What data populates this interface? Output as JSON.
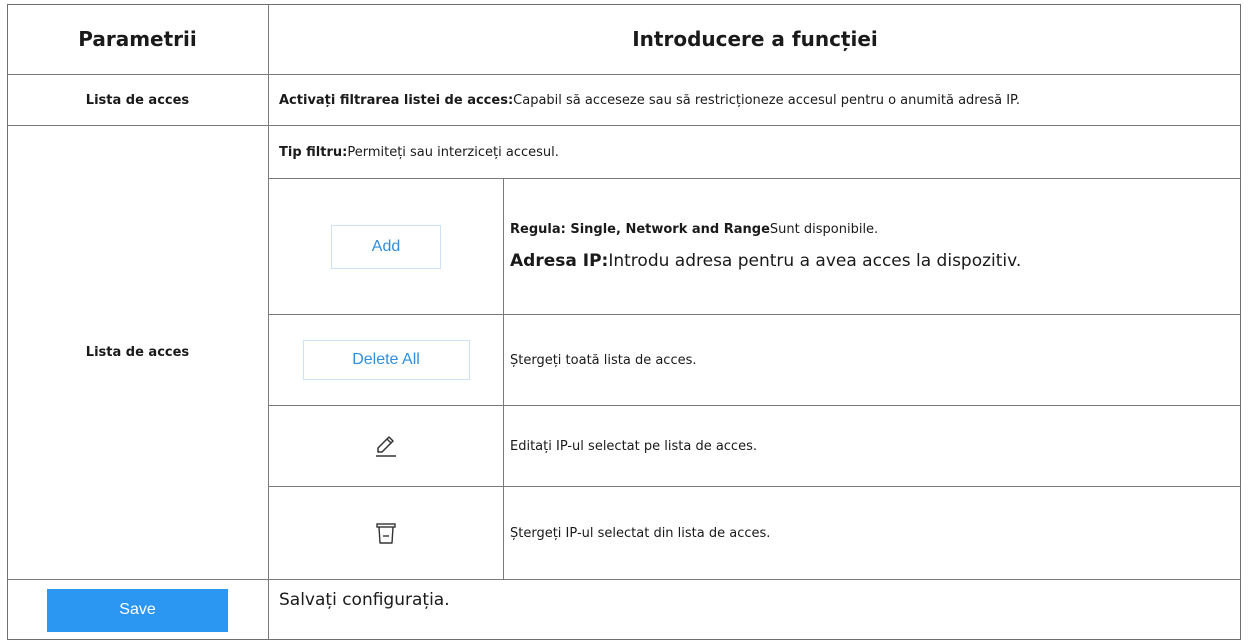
{
  "header": {
    "col1": "Parametrii",
    "col2": "Introducere a funcției"
  },
  "rows": {
    "access_list_filter": {
      "param": "Lista de acces",
      "bold": "Activați filtrarea listei de acces:",
      "text": "Capabil să acceseze sau să restricționeze accesul pentru o anumită adresă IP."
    },
    "access_list": {
      "param": "Lista de acces",
      "filter_type_bold": "Tip filtru:",
      "filter_type_text": "Permiteți sau interziceți accesul.",
      "add": {
        "button_label": "Add",
        "rule_bold": "Regula: Single, Network and Range",
        "rule_text": "Sunt disponibile.",
        "ip_bold": "Adresa IP:",
        "ip_text": "Introdu adresa pentru a avea acces la dispozitiv."
      },
      "delete_all": {
        "button_label": "Delete All",
        "text": "Ștergeți toată lista de acces."
      },
      "edit": {
        "icon": "pencil-icon",
        "text": "Editați IP-ul selectat pe lista de acces."
      },
      "delete": {
        "icon": "trash-icon",
        "text": "Ștergeți IP-ul selectat din lista de acces."
      }
    },
    "save": {
      "button_label": "Save",
      "text": "Salvați configurația."
    }
  },
  "colors": {
    "accent_blue": "#2b97f3",
    "button_text_blue": "#2e8fe0",
    "border": "#7a7a7a"
  }
}
